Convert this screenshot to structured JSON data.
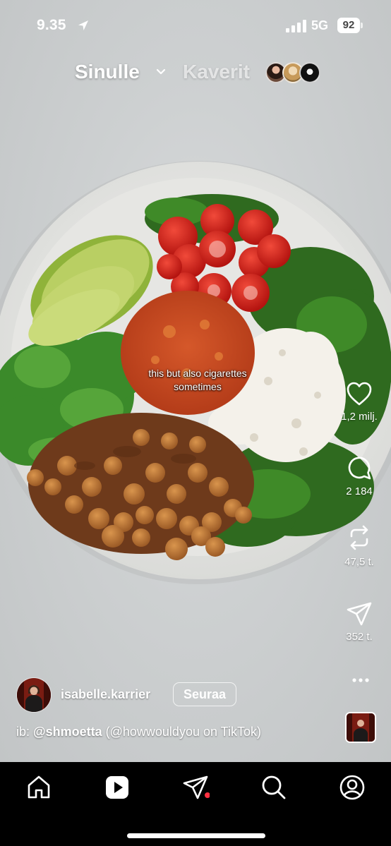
{
  "status_bar": {
    "time": "9.35",
    "network": "5G",
    "battery": "92"
  },
  "top_tabs": {
    "for_you": "Sinulle",
    "friends": "Kaverit"
  },
  "reel": {
    "caption": "this but also cigarettes sometimes",
    "likes": "1,2 milj.",
    "comments": "2 184",
    "reposts": "47,5 t.",
    "shares": "352 t."
  },
  "author": {
    "username": "isabelle.karrier",
    "follow_label": "Seuraa",
    "description_prefix": "ib:",
    "description_handle": "@shmoetta",
    "description_rest": "(@howwouldyou on TikTok)"
  },
  "nav": {
    "items": [
      "home-icon",
      "reels-icon",
      "send-icon",
      "search-icon",
      "profile-icon"
    ]
  },
  "colors": {
    "nav_background": "#000000",
    "notification_dot": "#ff3040"
  }
}
